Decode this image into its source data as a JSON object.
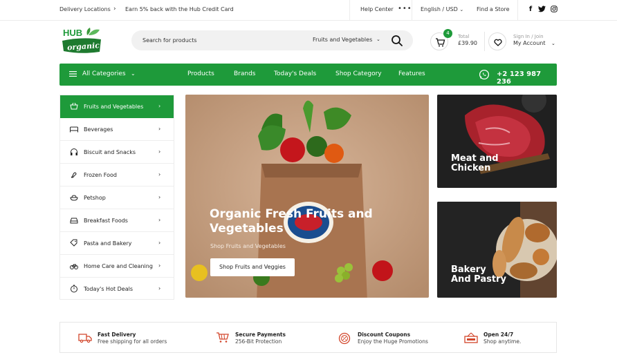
{
  "topbar": {
    "delivery": "Delivery Locations",
    "promo": "Earn 5% back with the Hub Credit Card",
    "help": "Help Center",
    "language": "English / USD",
    "find_store": "Find a Store"
  },
  "brand": {
    "logo_top": "HUB",
    "logo_bottom": "organic",
    "accent": "#1e9a3a"
  },
  "search": {
    "placeholder": "Search for products",
    "category": "Fruits and Vegetables"
  },
  "cart": {
    "count": "4",
    "total_label": "Total",
    "total_value": "£39.90"
  },
  "account": {
    "label": "Sign In / Join",
    "value": "My Account"
  },
  "nav": {
    "all_categories": "All Categories",
    "items": [
      "Products",
      "Brands",
      "Today's Deals",
      "Shop Category",
      "Features"
    ],
    "phone": "+2 123 987 236"
  },
  "sidebar": {
    "items": [
      {
        "label": "Fruits and Vegetables",
        "icon": "basket-icon"
      },
      {
        "label": "Beverages",
        "icon": "bed-icon"
      },
      {
        "label": "Biscuit and Snacks",
        "icon": "headphones-icon"
      },
      {
        "label": "Frozen Food",
        "icon": "hand-icon"
      },
      {
        "label": "Petshop",
        "icon": "food-bowl-icon"
      },
      {
        "label": "Breakfast Foods",
        "icon": "car-icon"
      },
      {
        "label": "Pasta and Bakery",
        "icon": "tag-icon"
      },
      {
        "label": "Home Care and Cleaning",
        "icon": "bicycle-icon"
      },
      {
        "label": "Today's Hot Deals",
        "icon": "stopwatch-icon"
      }
    ]
  },
  "hero": {
    "title": "Organic Fresh Fruits and Vegetables",
    "subtitle": "Shop Fruits and Vegetables",
    "button": "Shop Fruits and Veggies"
  },
  "promos": [
    {
      "title_1": "Meat and",
      "title_2": "Chicken"
    },
    {
      "title_1": "Bakery",
      "title_2": "And Pastry"
    }
  ],
  "features": [
    {
      "title": "Fast Delivery",
      "desc": "Free shipping for all orders",
      "icon": "truck-icon"
    },
    {
      "title": "Secure Payments",
      "desc": "256-Bit Protection",
      "icon": "cart-icon"
    },
    {
      "title": "Discount Coupons",
      "desc": "Enjoy the Huge Promotions",
      "icon": "coupon-icon"
    },
    {
      "title": "Open 24/7",
      "desc": "Shop anytime.",
      "icon": "open-sign-icon"
    }
  ]
}
